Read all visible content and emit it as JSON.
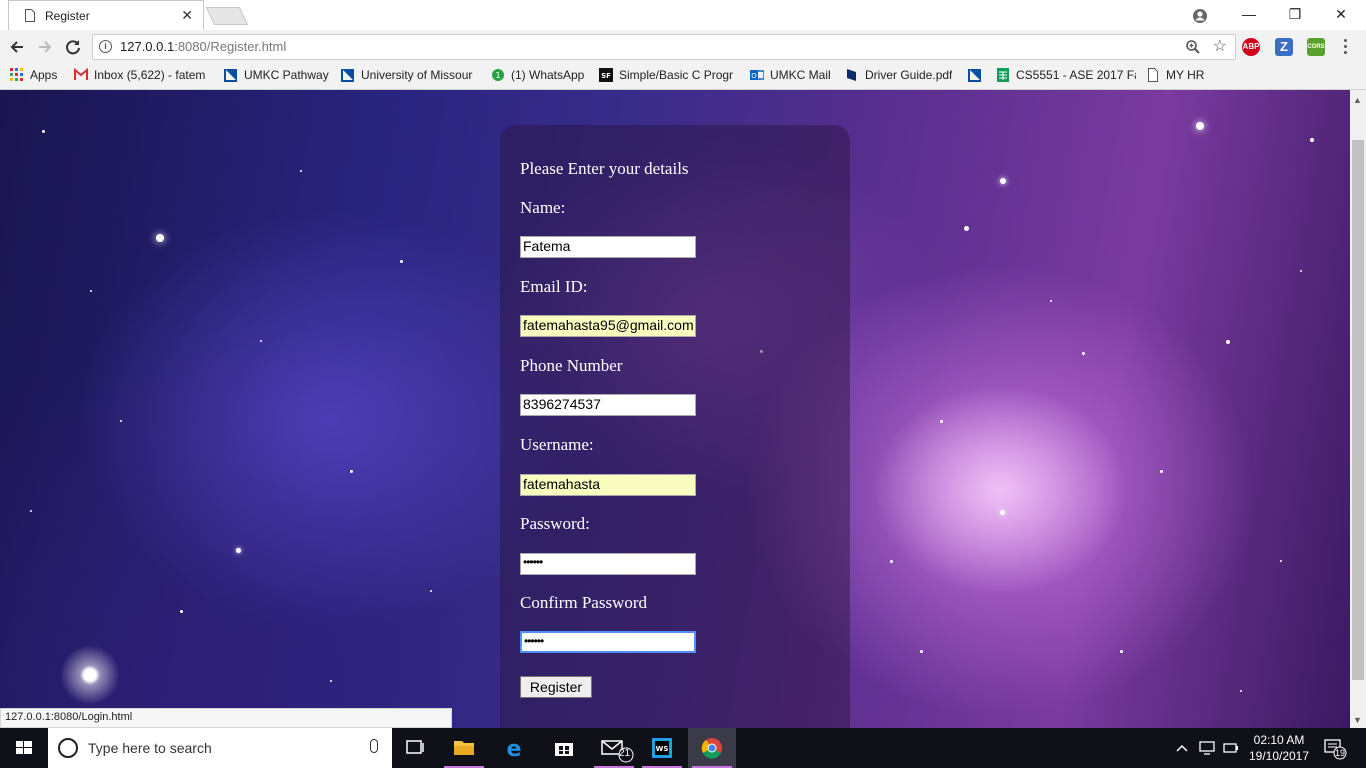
{
  "browser": {
    "tab_title": "Register",
    "tab_close": "✕",
    "window_controls": {
      "minimize": "—",
      "maximize": "❐",
      "close": "✕"
    },
    "url_host": "127.0.0.1",
    "url_rest": ":8080/Register.html",
    "extensions": {
      "abp": "ABP",
      "z": "Z",
      "cors": "CORS"
    }
  },
  "bookmarks": [
    {
      "label": "Apps",
      "icon": "apps-grid-icon"
    },
    {
      "label": "Inbox (5,622) - fatem",
      "icon": "gmail-icon"
    },
    {
      "label": "UMKC Pathway",
      "icon": "umkc-flag-icon"
    },
    {
      "label": "University of Missour",
      "icon": "umkc-flag-icon"
    },
    {
      "label": "(1) WhatsApp",
      "icon": "whatsapp-icon"
    },
    {
      "label": "Simple/Basic C Progr",
      "icon": "sf-icon"
    },
    {
      "label": "UMKC Mail",
      "icon": "outlook-icon"
    },
    {
      "label": "Driver Guide.pdf",
      "icon": "pdf-icon"
    },
    {
      "label": "CS5551 - ASE 2017 Fa",
      "icon": "sheets-icon"
    },
    {
      "label": "MY HR",
      "icon": "page-icon"
    }
  ],
  "form": {
    "heading": "Please Enter your details",
    "name_label": "Name:",
    "name_value": "Fatema",
    "email_label": "Email ID:",
    "email_value": "fatemahasta95@gmail.com",
    "phone_label": "Phone Number",
    "phone_value": "8396274537",
    "username_label": "Username:",
    "username_value": "fatemahasta",
    "password_label": "Password:",
    "password_value": "••••••",
    "confirm_label": "Confirm Password",
    "confirm_value": "••••••",
    "register_label": "Register"
  },
  "status_bar": "127.0.0.1:8080/Login.html",
  "taskbar": {
    "search_placeholder": "Type here to search",
    "mail_badge": "21",
    "time": "02:10 AM",
    "date": "19/10/2017",
    "notification_count": "19"
  }
}
